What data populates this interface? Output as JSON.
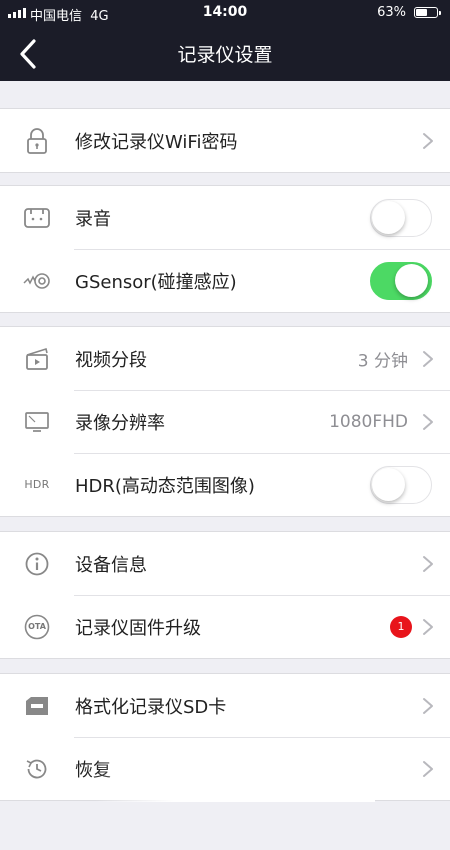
{
  "status_bar": {
    "carrier": "中国电信",
    "network": "4G",
    "time": "14:00",
    "battery": "63%",
    "battery_level": 0.63
  },
  "header": {
    "title": "记录仪设置"
  },
  "groups": [
    {
      "items": [
        {
          "label": "修改记录仪WiFi密码",
          "icon": "lock-icon",
          "type": "chevron"
        }
      ]
    },
    {
      "items": [
        {
          "label": "录音",
          "icon": "microphone-icon",
          "type": "toggle",
          "on": false
        },
        {
          "label": "GSensor(碰撞感应)",
          "icon": "gsensor-icon",
          "type": "toggle",
          "on": true
        }
      ]
    },
    {
      "items": [
        {
          "label": "视频分段",
          "icon": "clapperboard-icon",
          "type": "chevron",
          "value": "3 分钟"
        },
        {
          "label": "录像分辨率",
          "icon": "monitor-icon",
          "type": "chevron",
          "value": "1080FHD"
        },
        {
          "label": "HDR(高动态范围图像)",
          "icon": "hdr-icon",
          "icon_text": "HDR",
          "type": "toggle",
          "on": false
        }
      ]
    },
    {
      "items": [
        {
          "label": "设备信息",
          "icon": "info-icon",
          "type": "chevron"
        },
        {
          "label": "记录仪固件升级",
          "icon": "ota-icon",
          "icon_text": "OTA",
          "type": "chevron",
          "badge": "1"
        }
      ]
    },
    {
      "items": [
        {
          "label": "格式化记录仪SD卡",
          "icon": "sd-card-icon",
          "type": "chevron"
        },
        {
          "label": "恢复",
          "icon": "history-icon",
          "type": "chevron"
        }
      ]
    }
  ],
  "colors": {
    "header_bg": "#1b1c28",
    "toggle_on": "#4cd964",
    "badge": "#e8141b",
    "page_bg": "#efeff4"
  }
}
